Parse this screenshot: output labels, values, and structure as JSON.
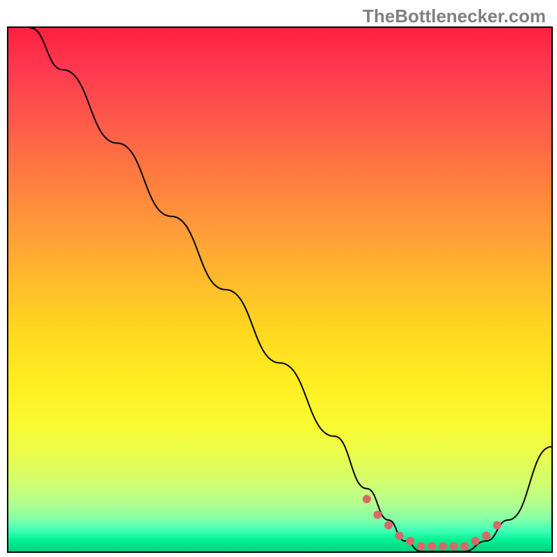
{
  "watermark": "TheBottlenecker.com",
  "chart_data": {
    "type": "line",
    "title": "",
    "xlabel": "",
    "ylabel": "",
    "xlim": [
      0,
      100
    ],
    "ylim": [
      0,
      100
    ],
    "series": [
      {
        "name": "bottleneck-curve",
        "x": [
          4,
          10,
          20,
          30,
          40,
          50,
          60,
          66,
          70,
          73,
          76,
          80,
          84,
          88,
          92,
          100
        ],
        "y": [
          100,
          92,
          78,
          64,
          50,
          36,
          22,
          12,
          6,
          2,
          0,
          0,
          0,
          2,
          6,
          20
        ]
      }
    ],
    "markers": {
      "name": "optimal-range-dots",
      "color": "#d86868",
      "x": [
        66,
        68,
        70,
        72,
        74,
        76,
        78,
        80,
        82,
        84,
        86,
        88,
        90
      ],
      "y": [
        10,
        7,
        5,
        3,
        2,
        1,
        1,
        1,
        1,
        1,
        2,
        3,
        5
      ]
    }
  }
}
